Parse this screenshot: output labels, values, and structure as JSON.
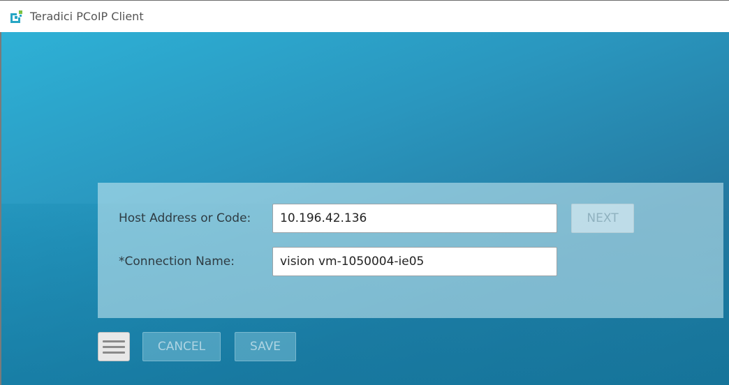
{
  "window": {
    "title": "Teradici PCoIP Client",
    "app_icon": "teradici-logo-icon"
  },
  "form": {
    "host_label": "Host Address or Code:",
    "host_value": "10.196.42.136",
    "connection_label": "*Connection Name:",
    "connection_value": "vision vm-1050004-ie05",
    "next_label": "NEXT"
  },
  "footer": {
    "menu_icon": "hamburger-menu-icon",
    "cancel_label": "CANCEL",
    "save_label": "SAVE"
  },
  "colors": {
    "background_light": "#2eb1d6",
    "background_dark": "#1e6e92",
    "logo_teal": "#27a6c4",
    "logo_green": "#7cc242"
  }
}
